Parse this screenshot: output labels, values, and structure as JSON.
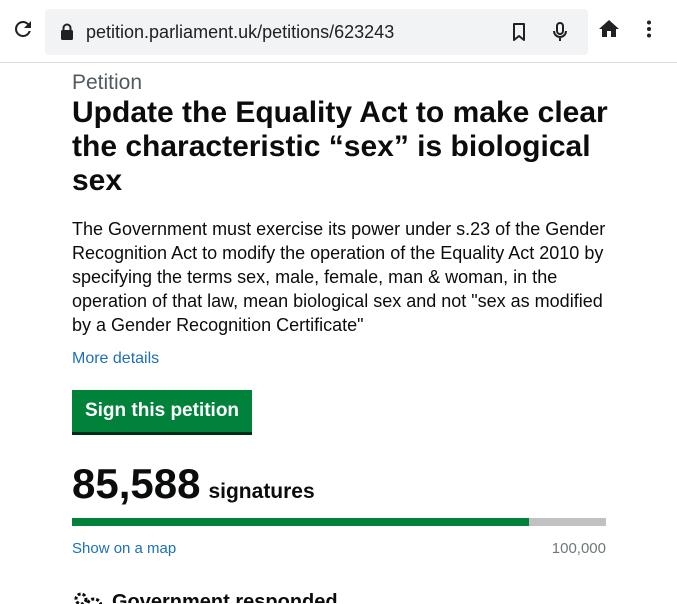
{
  "browser": {
    "url": "petition.parliament.uk/petitions/623243"
  },
  "petition": {
    "caption": "Petition",
    "title": "Update the Equality Act to make clear the characteristic “sex” is biological sex",
    "description": "The Government must exercise its power under s.23 of the Gender Recognition Act to modify the operation of the Equality Act 2010 by specifying the terms sex, male, female, man & woman, in the operation of that law, mean biological sex and not \"sex as modified by a Gender Recognition Certificate\"",
    "more_details": "More details",
    "sign_button": "Sign this petition",
    "signature_count": "85,588",
    "signatures_label": "signatures",
    "progress_fraction": 0.85588,
    "map_link": "Show on a map",
    "target": "100,000",
    "next_heading": "Government responded"
  },
  "colors": {
    "green": "#00823b",
    "link": "#1d70b8",
    "progress_track": "#bfc1c3"
  },
  "icons": [
    "reload-icon",
    "lock-icon",
    "bookmark-icon",
    "microphone-icon",
    "home-icon",
    "more-vert-icon",
    "gear-icon"
  ]
}
